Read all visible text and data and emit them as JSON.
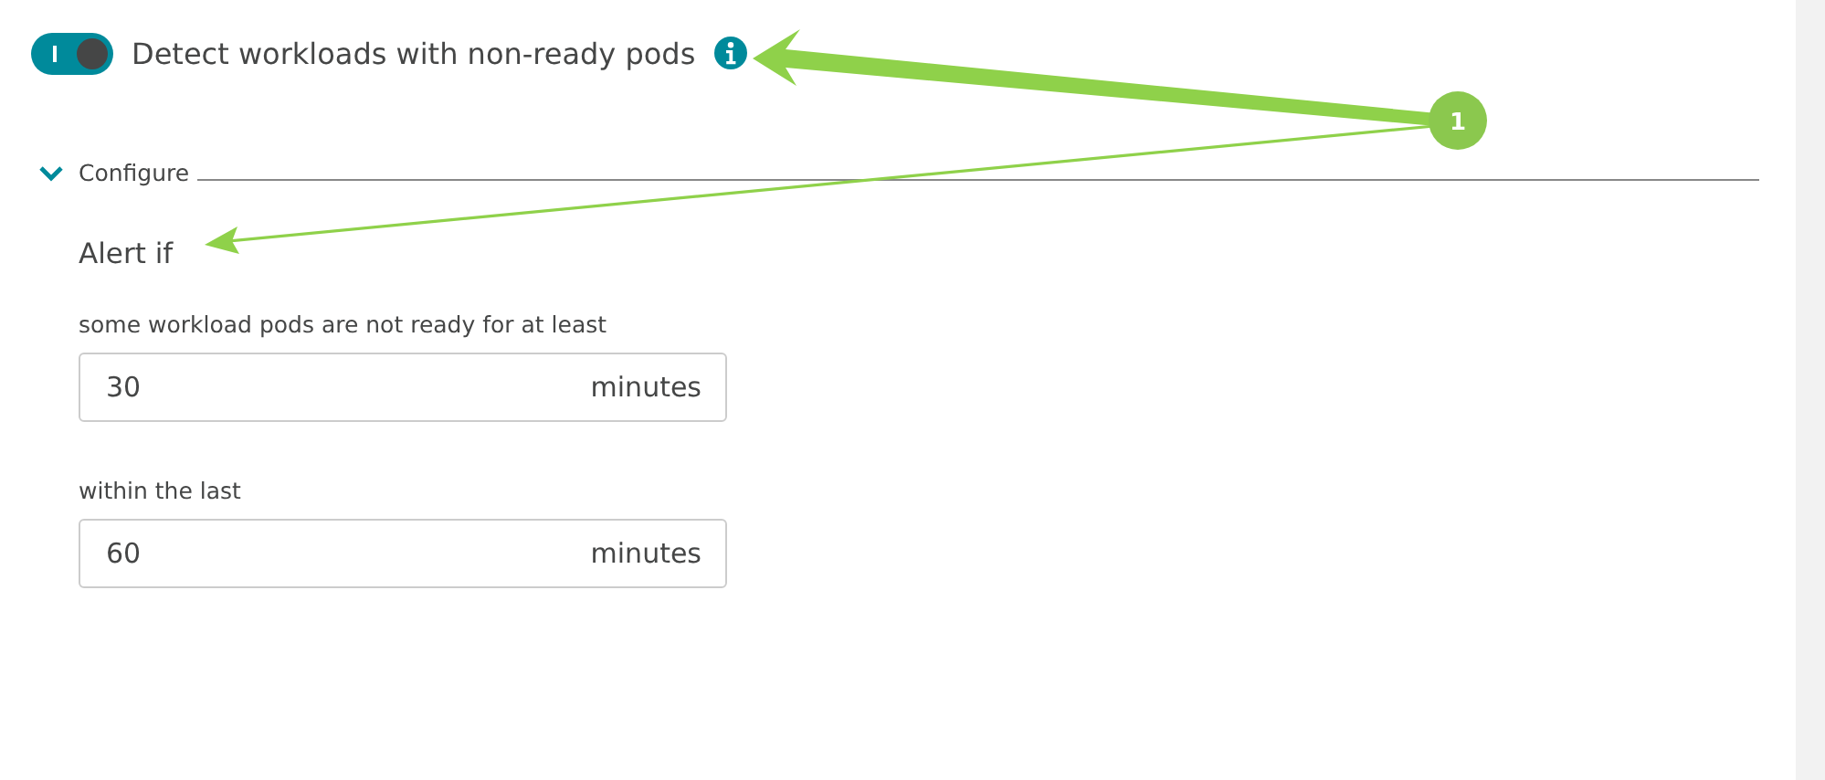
{
  "setting": {
    "label": "Detect workloads with non-ready pods",
    "on": true
  },
  "configure": {
    "label": "Configure",
    "expanded": true
  },
  "alert": {
    "heading": "Alert if",
    "fields": [
      {
        "label": "some workload pods are not ready for at least",
        "value": "30",
        "unit": "minutes"
      },
      {
        "label": "within the last",
        "value": "60",
        "unit": "minutes"
      }
    ]
  },
  "annotation": {
    "badge": "1"
  }
}
